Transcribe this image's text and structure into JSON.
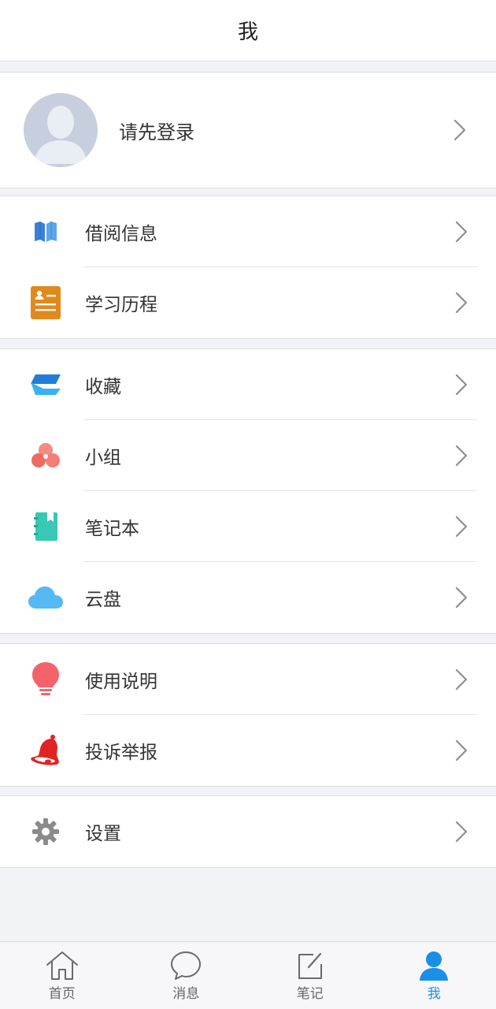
{
  "header": {
    "title": "我"
  },
  "profile": {
    "login_label": "请先登录"
  },
  "section_reading": {
    "items": [
      {
        "label": "借阅信息",
        "icon": "book-icon"
      },
      {
        "label": "学习历程",
        "icon": "study-history-icon"
      }
    ]
  },
  "section_content": {
    "items": [
      {
        "label": "收藏",
        "icon": "collection-icon"
      },
      {
        "label": "小组",
        "icon": "group-icon"
      },
      {
        "label": "笔记本",
        "icon": "notebook-icon"
      },
      {
        "label": "云盘",
        "icon": "cloud-icon"
      }
    ]
  },
  "section_help": {
    "items": [
      {
        "label": "使用说明",
        "icon": "lightbulb-icon"
      },
      {
        "label": "投诉举报",
        "icon": "bell-icon"
      }
    ]
  },
  "section_settings": {
    "items": [
      {
        "label": "设置",
        "icon": "gear-icon"
      }
    ]
  },
  "bottom_nav": {
    "items": [
      {
        "label": "首页",
        "icon": "home-icon",
        "active": false
      },
      {
        "label": "消息",
        "icon": "message-icon",
        "active": false
      },
      {
        "label": "笔记",
        "icon": "note-edit-icon",
        "active": false
      },
      {
        "label": "我",
        "icon": "user-icon",
        "active": true
      }
    ]
  },
  "colors": {
    "accent": "#1a8fe8",
    "background": "#f2f3f6",
    "book_icon": "#4a90e2",
    "study_icon": "#e08a1e",
    "collection_icon": "#2f9df3",
    "group_icon": "#f07b73",
    "notebook_icon": "#39c8b4",
    "cloud_icon": "#55b9f3",
    "lightbulb_icon": "#f4636a",
    "bell_icon": "#e02424",
    "gear_icon": "#8b8b8b"
  }
}
